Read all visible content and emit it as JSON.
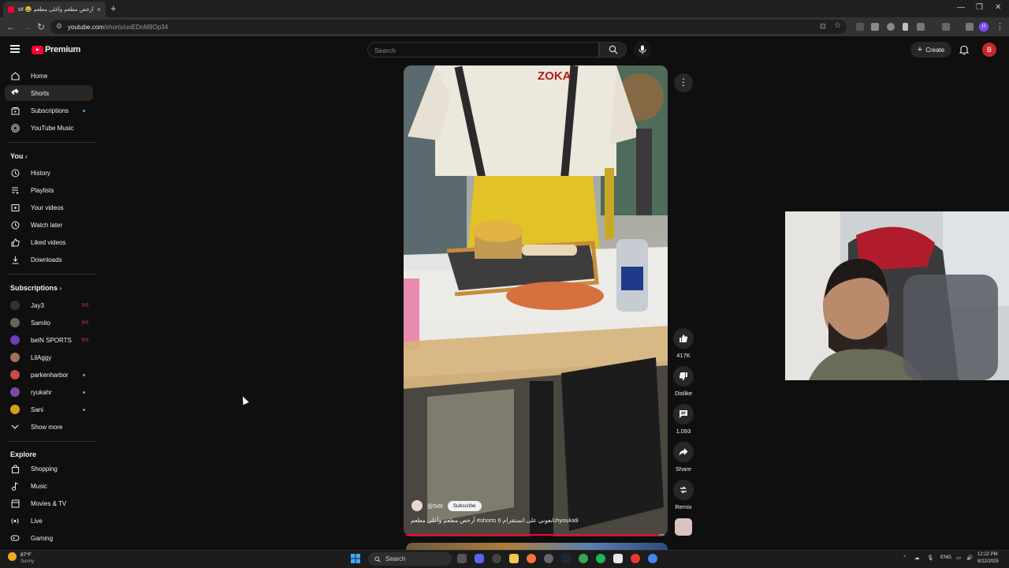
{
  "browser": {
    "tab_title": "أرخص مطعم وأغلى مطعم 😂 #shorts",
    "tab_close": "×",
    "new_tab": "+",
    "address_host": "youtube.com",
    "address_path": "/shorts/uoEDnM9Op34",
    "profile_initial": "H"
  },
  "header": {
    "logo_text": "Premium",
    "search_placeholder": "Search",
    "create_label": "Create",
    "avatar_initial": "B"
  },
  "sidebar": {
    "main": [
      {
        "label": "Home",
        "icon": "home-icon"
      },
      {
        "label": "Shorts",
        "icon": "shorts-icon",
        "active": true
      },
      {
        "label": "Subscriptions",
        "icon": "subscriptions-icon",
        "dot": true
      },
      {
        "label": "YouTube Music",
        "icon": "youtube-music-icon"
      }
    ],
    "you_title": "You",
    "you": [
      {
        "label": "History",
        "icon": "history-icon"
      },
      {
        "label": "Playlists",
        "icon": "playlists-icon"
      },
      {
        "label": "Your videos",
        "icon": "your-videos-icon"
      },
      {
        "label": "Watch later",
        "icon": "clock-icon"
      },
      {
        "label": "Liked videos",
        "icon": "thumbs-up-icon"
      },
      {
        "label": "Downloads",
        "icon": "download-icon"
      }
    ],
    "subs_title": "Subscriptions",
    "subs": [
      {
        "label": "Jay3",
        "color": "#333333",
        "status": "live"
      },
      {
        "label": "Samito",
        "color": "#5a6b5c",
        "status": "live"
      },
      {
        "label": "beIN SPORTS",
        "color": "#6a3fb5",
        "status": "live"
      },
      {
        "label": "LilAggy",
        "color": "#a0705a",
        "status": "none"
      },
      {
        "label": "parkenharbor",
        "color": "#c84b4b",
        "status": "dot"
      },
      {
        "label": "ryukahr",
        "color": "#7a4aa0",
        "status": "dot"
      },
      {
        "label": "Sani",
        "color": "#d4a017",
        "status": "dot"
      }
    ],
    "show_more": "Show more",
    "explore_title": "Explore",
    "explore": [
      {
        "label": "Shopping",
        "icon": "shopping-bag-icon"
      },
      {
        "label": "Music",
        "icon": "music-note-icon"
      },
      {
        "label": "Movies & TV",
        "icon": "clapperboard-icon"
      },
      {
        "label": "Live",
        "icon": "live-icon"
      },
      {
        "label": "Gaming",
        "icon": "gaming-icon"
      }
    ]
  },
  "short": {
    "channel": "@5i6f",
    "subscribe_label": "Subscribe",
    "title": "أرخص مطعم وأغلى مطعم #shorts تابعوني على انستقرام 6hyouka9",
    "progress": 0.98,
    "actions": [
      {
        "label": "417K",
        "icon": "thumbs-up-icon"
      },
      {
        "label": "Dislike",
        "icon": "thumbs-down-icon"
      },
      {
        "label": "1,093",
        "icon": "comment-icon"
      },
      {
        "label": "Share",
        "icon": "share-icon"
      },
      {
        "label": "Remix",
        "icon": "remix-icon"
      }
    ]
  },
  "taskbar": {
    "weather_temp": "87°F",
    "weather_desc": "Sunny",
    "search_label": "Search",
    "lang": "ENG",
    "time": "12:22 PM",
    "date": "8/22/2025"
  }
}
